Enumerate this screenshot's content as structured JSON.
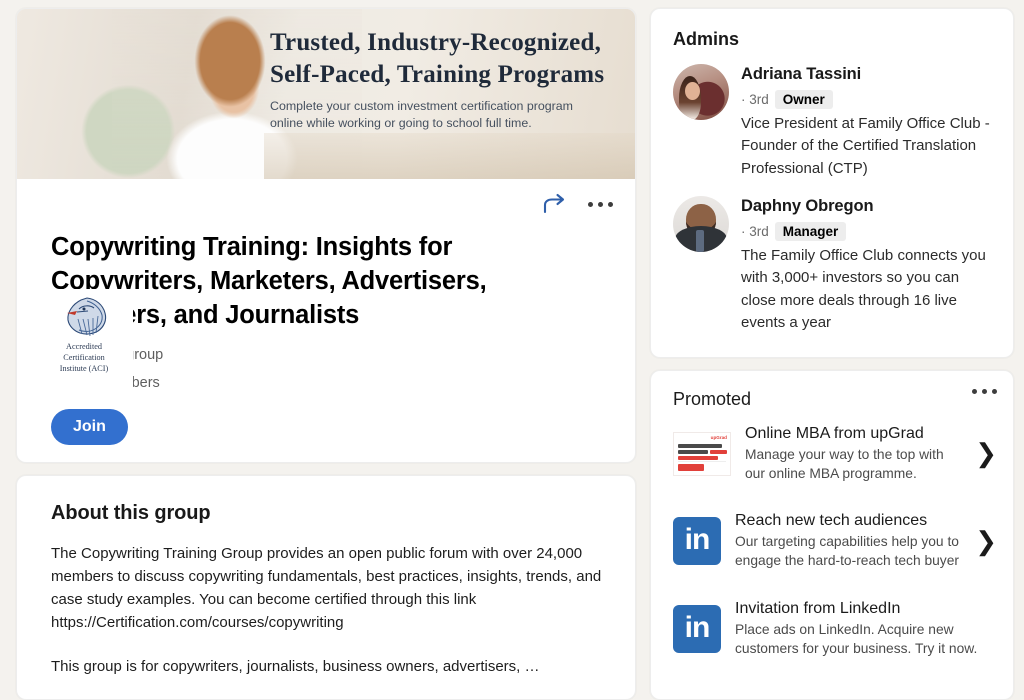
{
  "group": {
    "banner": {
      "headline_line1": "Trusted, Industry-Recognized,",
      "headline_line2": "Self-Paced, Training Programs",
      "subtext": "Complete your custom investment certification program online while working or going to school full time."
    },
    "logo": {
      "caption_line1": "Accredited",
      "caption_line2": "Certification",
      "caption_line3": "Institute (ACI)"
    },
    "actions": {
      "share_icon": "share-arrow-icon",
      "more_icon": "more-options-icon"
    },
    "title": "Copywriting Training: Insights for Copywriters, Marketers, Advertisers, Bloggers, and Journalists",
    "privacy_icon": "group-people-icon",
    "privacy": "Private group",
    "members": "31,781 members",
    "join_label": "Join"
  },
  "about": {
    "heading": "About this group",
    "paragraph1": "The Copywriting Training Group provides an open public forum with over 24,000 members to discuss copywriting fundamentals, best practices, insights, trends, and case study examples.  You can become certified through this link  https://Certification.com/courses/copywriting",
    "paragraph2": "This group is for copywriters, journalists, business owners, advertisers, …"
  },
  "admins": {
    "heading": "Admins",
    "items": [
      {
        "name": "Adriana Tassini",
        "degree": "· 3rd",
        "badge": "Owner",
        "description": "Vice President at Family Office Club - Founder of the Certified Translation Professional (CTP)",
        "avatar_icon": "avatar-adriana-tassini"
      },
      {
        "name": "Daphny Obregon",
        "degree": "· 3rd",
        "badge": "Manager",
        "description": "The Family Office Club connects you with 3,000+ investors so you can close more deals through 16 live events a year",
        "avatar_icon": "avatar-daphny-obregon"
      }
    ]
  },
  "promoted": {
    "heading": "Promoted",
    "more_icon": "more-options-icon",
    "items": [
      {
        "title": "Online MBA from upGrad",
        "description": "Manage your way to the top with our online MBA programme.",
        "thumb_icon": "upgrad-ad-thumbnail",
        "chevron_icon": "chevron-right-icon",
        "ad_brand": "upGrad",
        "ad_copy": "Learn your way to the top with online MBA programs",
        "ad_cta": "Explore Now"
      },
      {
        "title": "Reach new tech audiences",
        "description": "Our targeting capabilities help you to engage the hard-to-reach tech buyer",
        "thumb_icon": "linkedin-logo-icon",
        "chevron_icon": "chevron-right-icon",
        "logo_text": "in"
      },
      {
        "title": "Invitation from LinkedIn",
        "description": "Place ads on LinkedIn. Acquire new customers for your business. Try it now.",
        "thumb_icon": "linkedin-logo-icon",
        "logo_text": "in"
      }
    ]
  },
  "colors": {
    "page_background": "#f4f2ee",
    "card_background": "#ffffff",
    "primary_blue": "#3370cf",
    "linkedin_blue": "#2c6cb3",
    "badge_background": "#ededed",
    "upgrad_red": "#e1403a"
  }
}
